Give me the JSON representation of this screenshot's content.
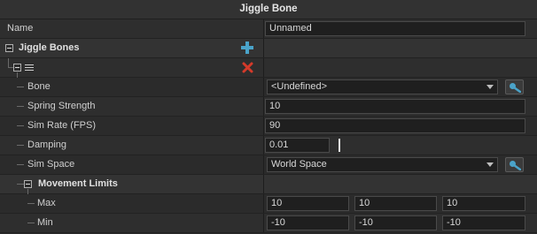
{
  "window": {
    "title": "Jiggle Bone"
  },
  "name_row": {
    "label": "Name",
    "value": "Unnamed"
  },
  "jiggle_bones": {
    "label": "Jiggle Bones",
    "add_icon": "plus-icon",
    "item": {
      "reorder_icon": "hamburger-icon",
      "delete_icon": "red-x-icon",
      "bone": {
        "label": "Bone",
        "value": "<Undefined>",
        "picker_icon": "eyedropper-icon"
      },
      "spring_strength": {
        "label": "Spring Strength",
        "value": "10"
      },
      "sim_rate": {
        "label": "Sim Rate (FPS)",
        "value": "90"
      },
      "damping": {
        "label": "Damping",
        "value": "0.01",
        "slider_fraction": 0.01
      },
      "sim_space": {
        "label": "Sim Space",
        "value": "World Space",
        "picker_icon": "eyedropper-icon"
      },
      "movement_limits": {
        "label": "Movement Limits",
        "max": {
          "label": "Max",
          "x": "10",
          "y": "10",
          "z": "10"
        },
        "min": {
          "label": "Min",
          "x": "-10",
          "y": "-10",
          "z": "-10"
        }
      }
    }
  },
  "colors": {
    "add_icon": "#4aa3c9",
    "delete_icon": "#d43a2a",
    "picker_icon": "#4aa3c9"
  }
}
